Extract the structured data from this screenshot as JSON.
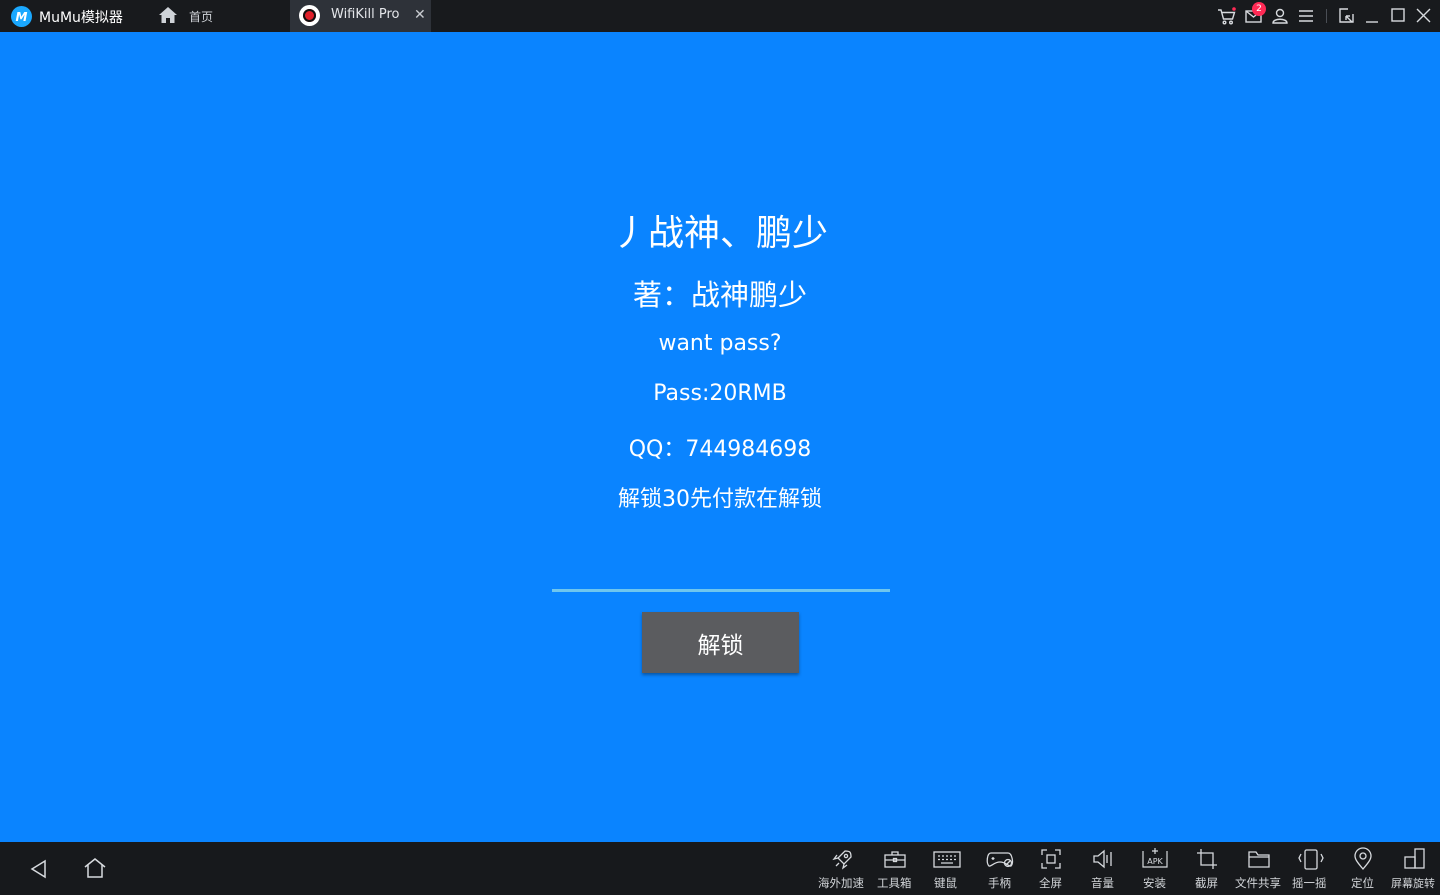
{
  "titlebar": {
    "brand": "MuMu模拟器",
    "brand_logo_text": "M",
    "tabs": [
      {
        "label": "首页",
        "icon": "home-icon"
      },
      {
        "label": "WifiKill Pro",
        "icon": "app-icon",
        "active": true
      }
    ],
    "close_tab_glyph": "✕",
    "mail_badge": "2",
    "icons": [
      "cart-icon",
      "mail-icon",
      "user-icon",
      "menu-icon",
      "shrink-icon",
      "minimize-icon",
      "maximize-icon",
      "close-icon"
    ]
  },
  "main": {
    "heading": "丿战神、鹏少",
    "author": "著：战神鹏少",
    "want_pass": "want pass?",
    "price": "Pass:20RMB",
    "qq": "QQ：744984698",
    "notice": "解锁30先付款在解锁",
    "password_value": "",
    "unlock_button": "解锁"
  },
  "bottombar": {
    "nav": [
      {
        "name": "back",
        "icon": "back-icon"
      },
      {
        "name": "home",
        "icon": "home-outline-icon"
      }
    ],
    "tools": [
      {
        "label": "海外加速",
        "icon": "rocket-icon"
      },
      {
        "label": "工具箱",
        "icon": "toolbox-icon"
      },
      {
        "label": "键鼠",
        "icon": "keyboard-icon"
      },
      {
        "label": "手柄",
        "icon": "gamepad-icon"
      },
      {
        "label": "全屏",
        "icon": "fullscreen-icon"
      },
      {
        "label": "音量",
        "icon": "volume-icon"
      },
      {
        "label": "安装",
        "icon": "apk-icon"
      },
      {
        "label": "截屏",
        "icon": "crop-icon"
      },
      {
        "label": "文件共享",
        "icon": "folder-icon"
      },
      {
        "label": "摇一摇",
        "icon": "shake-icon"
      },
      {
        "label": "定位",
        "icon": "location-icon"
      },
      {
        "label": "屏幕旋转",
        "icon": "rotate-icon"
      }
    ]
  },
  "colors": {
    "screen_bg": "#0a84ff",
    "titlebar_bg": "#181a1d",
    "active_tab_bg": "#2e3239",
    "input_underline": "#6fc6ee",
    "button_bg": "#5b5c5f",
    "badge": "#ff2a55"
  }
}
